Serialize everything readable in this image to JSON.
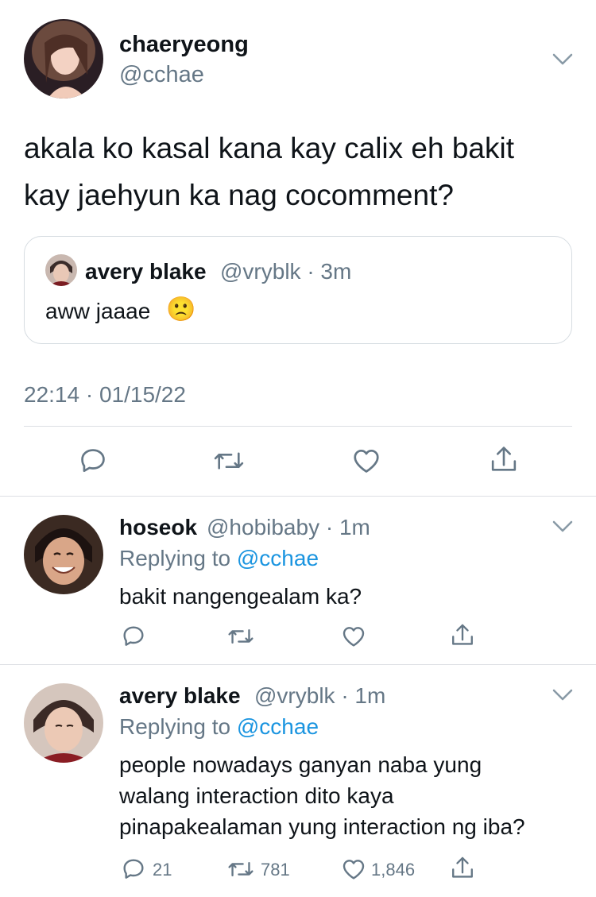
{
  "main_tweet": {
    "display_name": "chaeryeong",
    "handle": "@cchae",
    "text_line1": "akala ko kasal kana kay calix eh bakit",
    "text_line2": "kay jaehyun ka nag cocomment?",
    "quoted": {
      "display_name": "avery blake",
      "handle_time": "@vryblk · 3m",
      "text": "aww jaaae",
      "emoji": "🙁"
    },
    "timestamp": "22:14 · 01/15/22"
  },
  "replies": [
    {
      "display_name": "hoseok",
      "handle_time": "@hobibaby · 1m",
      "replying_label": "Replying to",
      "replying_handle": "@cchae",
      "text_lines": [
        "bakit nangengealam ka?"
      ],
      "counts": {
        "reply": "",
        "retweet": "",
        "like": ""
      }
    },
    {
      "display_name": "avery blake",
      "handle_time": "@vryblk · 1m",
      "replying_label": "Replying to",
      "replying_handle": "@cchae",
      "text_lines": [
        "people nowadays ganyan naba yung",
        "walang interaction dito kaya",
        "pinapakealaman yung interaction ng iba?"
      ],
      "counts": {
        "reply": "21",
        "retweet": "781",
        "like": "1,846"
      }
    }
  ],
  "icons": [
    "chevron-down-icon",
    "reply-icon",
    "retweet-icon",
    "like-icon",
    "share-icon"
  ],
  "colors": {
    "text": "#0f1419",
    "secondary": "#657786",
    "link": "#1b95e0",
    "divider": "#dcdfe3"
  }
}
